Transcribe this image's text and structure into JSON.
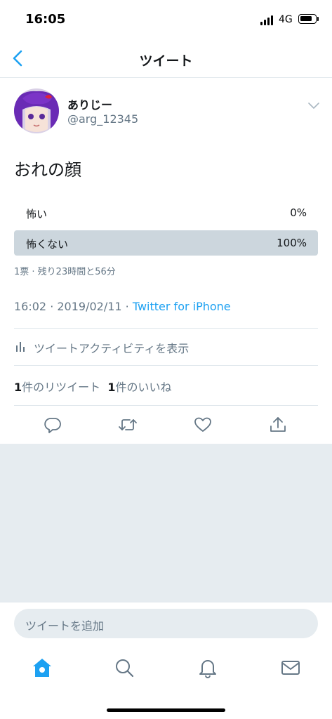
{
  "status_bar": {
    "time": "16:05",
    "network": "4G"
  },
  "nav": {
    "title": "ツイート",
    "back_icon": "chevron-left-icon"
  },
  "tweet": {
    "display_name": "ありじー",
    "handle": "@arg_12345",
    "text": "おれの顔",
    "poll": {
      "options": [
        {
          "label": "怖い",
          "percent_text": "0%",
          "percent": 0
        },
        {
          "label": "怖くない",
          "percent_text": "100%",
          "percent": 100
        }
      ],
      "summary": "1票 · 残り23時間と56分"
    },
    "timestamp": "16:02 · 2019/02/11 · ",
    "source": "Twitter for iPhone",
    "activity_label": "ツイートアクティビティを表示",
    "stats": {
      "retweets_count": "1",
      "retweets_label": "件のリツイート",
      "likes_count": "1",
      "likes_label": "件のいいね"
    }
  },
  "compose": {
    "placeholder": "ツイートを追加"
  },
  "tabs": [
    "home-icon",
    "search-icon",
    "bell-icon",
    "mail-icon"
  ],
  "colors": {
    "accent": "#1da1f2",
    "secondary_text": "#657786",
    "poll_fill": "#ccd6dd",
    "background_gray": "#e6ecf0"
  }
}
